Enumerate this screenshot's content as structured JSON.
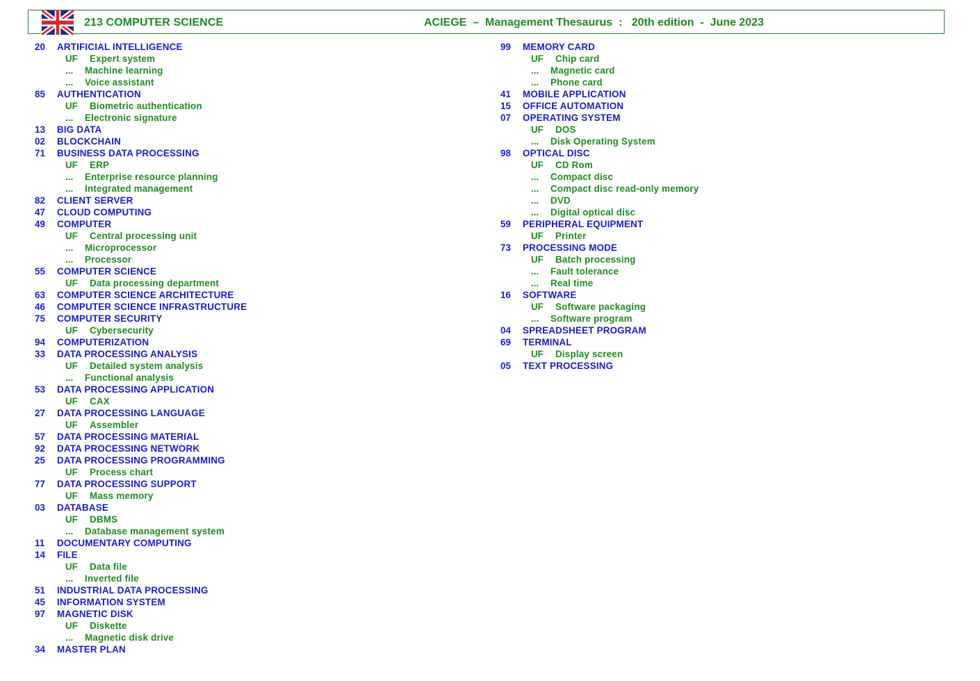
{
  "header": {
    "flag_icon": "uk-flag-icon",
    "title": "213  COMPUTER SCIENCE",
    "publication": "ACIEGE  –  Management Thesaurus  :   20th edition  -  June 2023"
  },
  "labels": {
    "uf": "UF",
    "see_also": "..."
  },
  "columns": [
    {
      "entries": [
        {
          "code": "20",
          "term": "ARTIFICIAL INTELLIGENCE",
          "uf": "Expert system",
          "related": [
            "Machine learning",
            "Voice assistant"
          ]
        },
        {
          "code": "85",
          "term": "AUTHENTICATION",
          "uf": "Biometric authentication",
          "related": [
            "Electronic signature"
          ]
        },
        {
          "code": "13",
          "term": "BIG DATA"
        },
        {
          "code": "02",
          "term": "BLOCKCHAIN"
        },
        {
          "code": "71",
          "term": "BUSINESS DATA PROCESSING",
          "uf": "ERP",
          "related": [
            "Enterprise resource planning",
            "Integrated management"
          ]
        },
        {
          "code": "82",
          "term": "CLIENT SERVER"
        },
        {
          "code": "47",
          "term": "CLOUD COMPUTING"
        },
        {
          "code": "49",
          "term": "COMPUTER",
          "uf": "Central processing unit",
          "related": [
            "Microprocessor",
            "Processor"
          ]
        },
        {
          "code": "55",
          "term": "COMPUTER SCIENCE",
          "uf": "Data processing department"
        },
        {
          "code": "63",
          "term": "COMPUTER SCIENCE ARCHITECTURE"
        },
        {
          "code": "46",
          "term": "COMPUTER SCIENCE INFRASTRUCTURE"
        },
        {
          "code": "75",
          "term": "COMPUTER SECURITY",
          "uf": "Cybersecurity"
        },
        {
          "code": "94",
          "term": "COMPUTERIZATION"
        },
        {
          "code": "33",
          "term": "DATA PROCESSING ANALYSIS",
          "uf": "Detailed system analysis",
          "related": [
            "Functional analysis"
          ]
        },
        {
          "code": "53",
          "term": "DATA PROCESSING APPLICATION",
          "uf": "CAX"
        },
        {
          "code": "27",
          "term": "DATA PROCESSING LANGUAGE",
          "uf": "Assembler"
        },
        {
          "code": "57",
          "term": "DATA PROCESSING MATERIAL"
        },
        {
          "code": "92",
          "term": "DATA PROCESSING NETWORK"
        },
        {
          "code": "25",
          "term": "DATA PROCESSING PROGRAMMING",
          "uf": "Process chart"
        },
        {
          "code": "77",
          "term": "DATA PROCESSING SUPPORT",
          "uf": "Mass memory"
        },
        {
          "code": "03",
          "term": "DATABASE",
          "uf": "DBMS",
          "related": [
            "Database management system"
          ]
        },
        {
          "code": "11",
          "term": "DOCUMENTARY COMPUTING"
        },
        {
          "code": "14",
          "term": "FILE",
          "uf": "Data file",
          "related": [
            "Inverted file"
          ]
        },
        {
          "code": "51",
          "term": "INDUSTRIAL DATA PROCESSING"
        },
        {
          "code": "45",
          "term": "INFORMATION SYSTEM"
        },
        {
          "code": "97",
          "term": "MAGNETIC DISK",
          "uf": "Diskette",
          "related": [
            "Magnetic disk drive"
          ]
        },
        {
          "code": "34",
          "term": "MASTER PLAN"
        }
      ]
    },
    {
      "entries": [
        {
          "code": "99",
          "term": "MEMORY CARD",
          "uf": "Chip card",
          "related": [
            "Magnetic card",
            "Phone card"
          ]
        },
        {
          "code": "41",
          "term": "MOBILE APPLICATION"
        },
        {
          "code": "15",
          "term": "OFFICE AUTOMATION"
        },
        {
          "code": "07",
          "term": "OPERATING SYSTEM",
          "uf": "DOS",
          "related": [
            "Disk Operating System"
          ]
        },
        {
          "code": "98",
          "term": "OPTICAL DISC",
          "uf": "CD Rom",
          "related": [
            "Compact disc",
            "Compact disc read-only memory",
            "DVD",
            "Digital optical disc"
          ]
        },
        {
          "code": "59",
          "term": "PERIPHERAL EQUIPMENT",
          "uf": "Printer"
        },
        {
          "code": "73",
          "term": "PROCESSING MODE",
          "uf": "Batch processing",
          "related": [
            "Fault tolerance",
            "Real time"
          ]
        },
        {
          "code": "16",
          "term": "SOFTWARE",
          "uf": "Software packaging",
          "related": [
            "Software program"
          ]
        },
        {
          "code": "04",
          "term": "SPREADSHEET PROGRAM"
        },
        {
          "code": "69",
          "term": "TERMINAL",
          "uf": "Display screen"
        },
        {
          "code": "05",
          "term": "TEXT PROCESSING"
        }
      ]
    }
  ]
}
